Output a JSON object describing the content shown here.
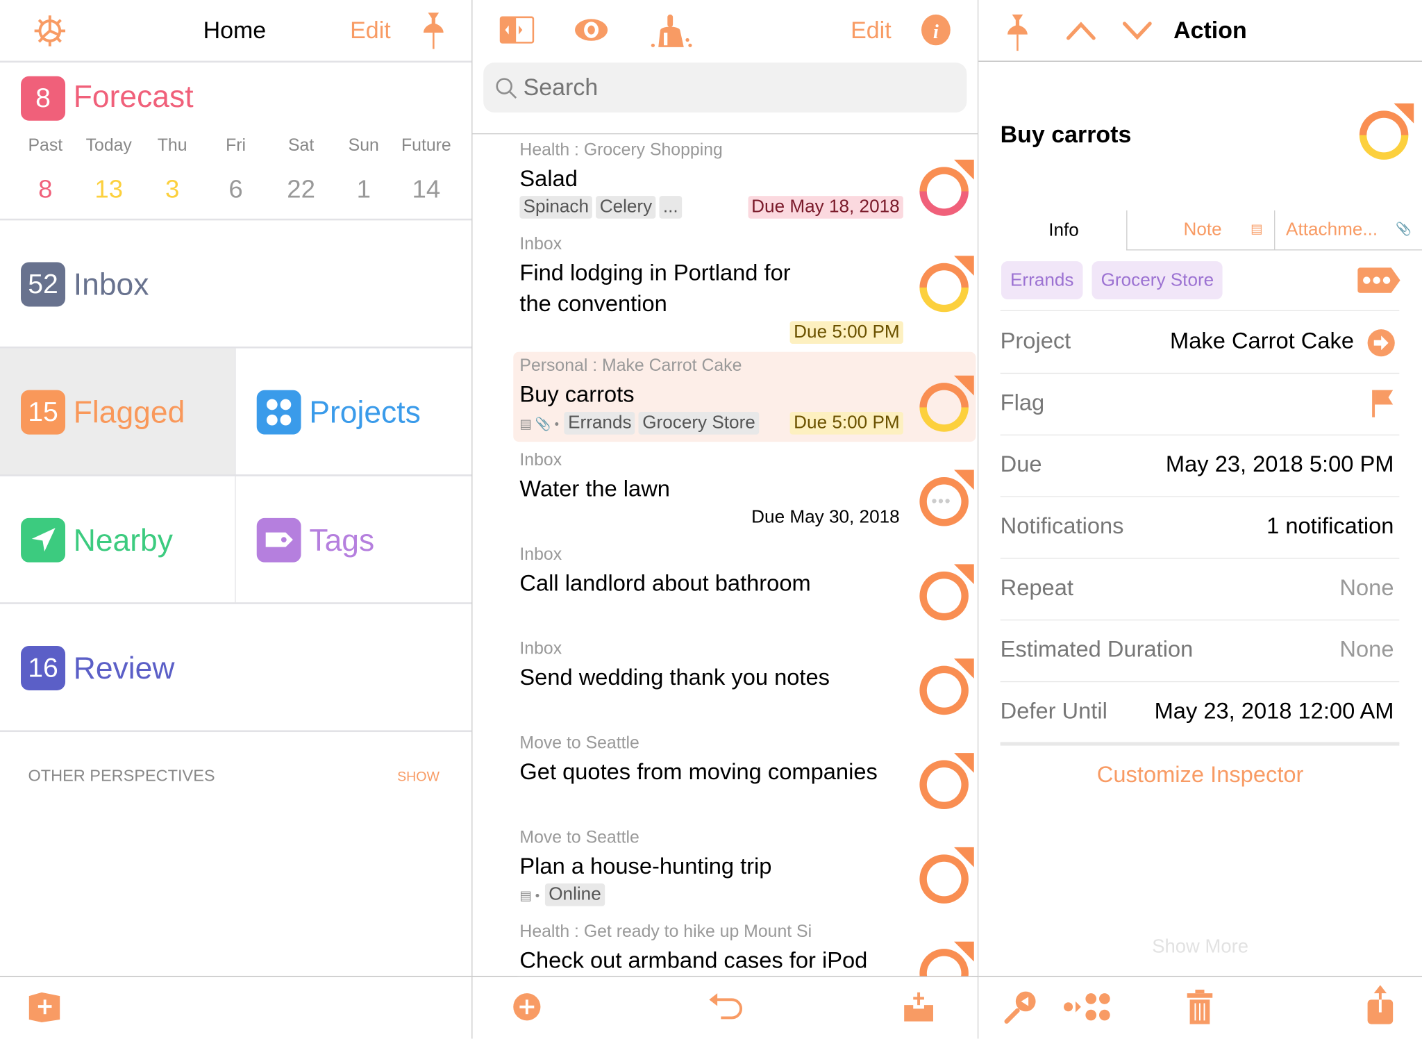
{
  "colors": {
    "accent": "#F89B64",
    "forecast": "#F0607A",
    "due_soon": "#FCD03D",
    "inbox": "#68728E",
    "flagged": "#F9985A",
    "projects": "#3A9BEA",
    "nearby": "#3CCB7F",
    "tags": "#B57FDE",
    "review": "#5B5FC7"
  },
  "home": {
    "title": "Home",
    "edit": "Edit",
    "icons": [
      "gear-icon",
      "pin-icon"
    ],
    "forecast": {
      "count": "8",
      "label": "Forecast",
      "days": [
        {
          "day": "Past",
          "count": "8"
        },
        {
          "day": "Today",
          "count": "13"
        },
        {
          "day": "Thu",
          "count": "3"
        },
        {
          "day": "Fri",
          "count": "6"
        },
        {
          "day": "Sat",
          "count": "22"
        },
        {
          "day": "Sun",
          "count": "1"
        },
        {
          "day": "Future",
          "count": "14"
        }
      ]
    },
    "inbox": {
      "count": "52",
      "label": "Inbox"
    },
    "flagged": {
      "count": "15",
      "label": "Flagged"
    },
    "projects": {
      "label": "Projects"
    },
    "nearby": {
      "label": "Nearby"
    },
    "tags": {
      "label": "Tags"
    },
    "review": {
      "count": "16",
      "label": "Review"
    },
    "other": {
      "label": "OTHER PERSPECTIVES",
      "show": "SHOW"
    }
  },
  "list": {
    "edit": "Edit",
    "search_placeholder": "Search",
    "items": [
      {
        "context": "Health : Grocery Shopping",
        "title": "Salad",
        "tags": [
          "Spinach",
          "Celery",
          "..."
        ],
        "due": "Due May 18, 2018",
        "status": "overdue"
      },
      {
        "context": "Inbox",
        "title": "Find lodging in Portland for the convention",
        "due": "Due 5:00 PM",
        "status": "due-soon"
      },
      {
        "context": "Personal : Make Carrot Cake",
        "title": "Buy carrots",
        "tags": [
          "Errands",
          "Grocery Store"
        ],
        "due": "Due 5:00 PM",
        "status": "due-soon",
        "selected": true
      },
      {
        "context": "Inbox",
        "title": "Water the lawn",
        "due": "Due May 30, 2018",
        "status": "deferred"
      },
      {
        "context": "Inbox",
        "title": "Call landlord about bathroom",
        "status": "available"
      },
      {
        "context": "Inbox",
        "title": "Send wedding thank you notes",
        "status": "available"
      },
      {
        "context": "Move to Seattle",
        "title": "Get quotes from moving companies",
        "status": "available"
      },
      {
        "context": "Move to Seattle",
        "title": "Plan a house-hunting trip",
        "tags": [
          "Online"
        ],
        "status": "available"
      },
      {
        "context": "Health : Get ready to hike up Mount Si",
        "title": "Check out armband cases for iPod",
        "status": "available"
      }
    ]
  },
  "inspector": {
    "title": "Action",
    "task": "Buy carrots",
    "tabs": {
      "info": "Info",
      "note": "Note",
      "attachments": "Attachme..."
    },
    "tags": [
      "Errands",
      "Grocery Store"
    ],
    "rows": [
      {
        "label": "Project",
        "value": "Make Carrot Cake"
      },
      {
        "label": "Flag",
        "value": ""
      },
      {
        "label": "Due",
        "value": "May 23, 2018  5:00 PM"
      },
      {
        "label": "Notifications",
        "value": "1 notification"
      },
      {
        "label": "Repeat",
        "value": "None"
      },
      {
        "label": "Estimated Duration",
        "value": "None"
      },
      {
        "label": "Defer Until",
        "value": "May 23, 2018  12:00 AM"
      }
    ],
    "customize": "Customize Inspector",
    "show_more": "Show More"
  }
}
